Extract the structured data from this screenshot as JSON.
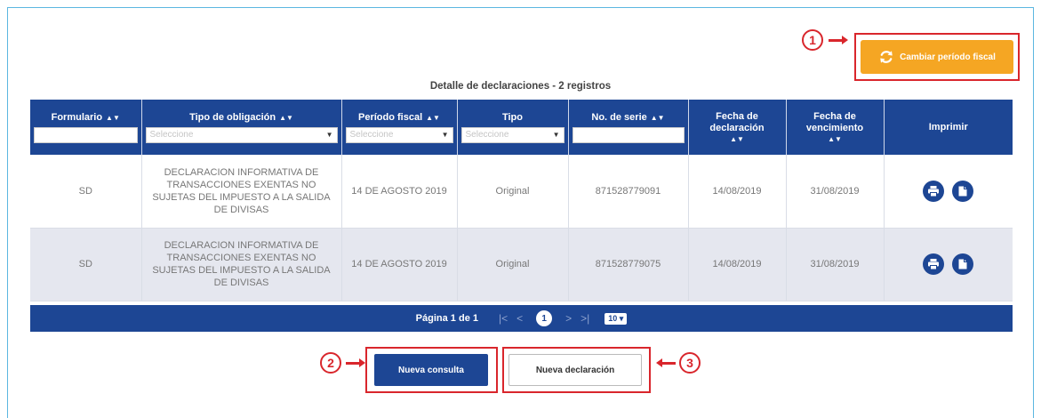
{
  "actions": {
    "cambiar_periodo_label": "Cambiar período fiscal",
    "nueva_consulta_label": "Nueva consulta",
    "nueva_declaracion_label": "Nueva declaración"
  },
  "annotations": [
    "1",
    "2",
    "3"
  ],
  "table": {
    "title": "Detalle de declaraciones - 2 registros",
    "columns": [
      {
        "label": "Formulario",
        "filter": "input"
      },
      {
        "label": "Tipo de obligación",
        "filter": "select",
        "placeholder": "Seleccione"
      },
      {
        "label": "Período fiscal",
        "filter": "select",
        "placeholder": "Seleccione"
      },
      {
        "label": "Tipo",
        "filter": "select",
        "placeholder": "Seleccione"
      },
      {
        "label": "No. de serie",
        "filter": "input"
      },
      {
        "label": "Fecha de declaración",
        "filter": "none"
      },
      {
        "label": "Fecha de vencimiento",
        "filter": "none"
      },
      {
        "label": "Imprimir",
        "filter": "none"
      }
    ],
    "rows": [
      {
        "formulario": "SD",
        "tipo_obligacion": "DECLARACION INFORMATIVA DE TRANSACCIONES EXENTAS NO SUJETAS DEL IMPUESTO A LA SALIDA DE DIVISAS",
        "periodo_fiscal": "14 DE AGOSTO 2019",
        "tipo": "Original",
        "no_serie": "871528779091",
        "fecha_declaracion": "14/08/2019",
        "fecha_vencimiento": "31/08/2019"
      },
      {
        "formulario": "SD",
        "tipo_obligacion": "DECLARACION INFORMATIVA DE TRANSACCIONES EXENTAS NO SUJETAS DEL IMPUESTO A LA SALIDA DE DIVISAS",
        "periodo_fiscal": "14 DE AGOSTO 2019",
        "tipo": "Original",
        "no_serie": "871528779075",
        "fecha_declaracion": "14/08/2019",
        "fecha_vencimiento": "31/08/2019"
      }
    ]
  },
  "pagination": {
    "label": "Página 1 de 1",
    "first": "|<",
    "prev": "<",
    "current": "1",
    "next": ">",
    "last": ">|",
    "page_size": "10"
  },
  "colors": {
    "primary": "#1d4694",
    "accent": "#f5a623",
    "annotation": "#d9262c"
  }
}
